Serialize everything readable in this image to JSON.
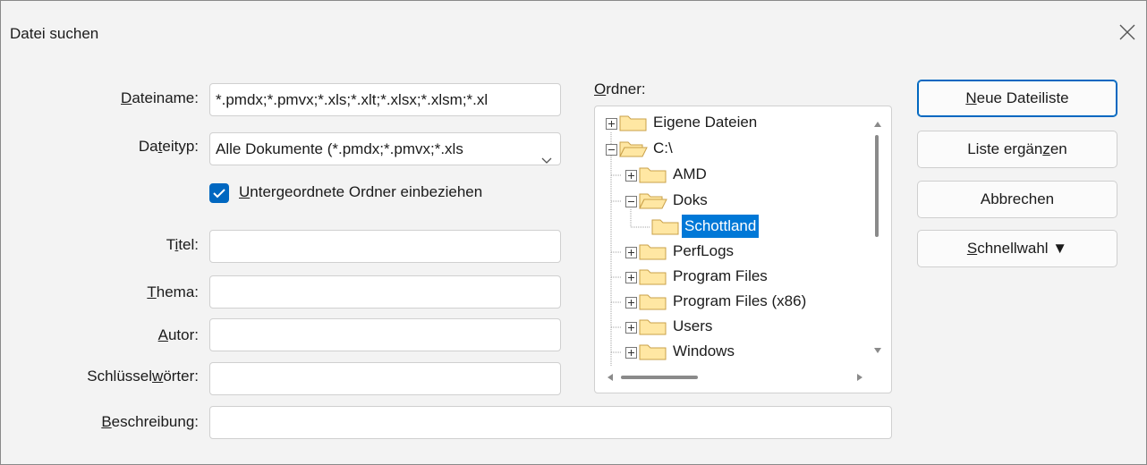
{
  "window": {
    "title": "Datei suchen"
  },
  "form": {
    "filename_label": "Dateiname:",
    "filename_value": "*.pmdx;*.pmvx;*.xls;*.xlt;*.xlsx;*.xlsm;*.xl",
    "filetype_label": "Dateityp:",
    "filetype_value": "Alle Dokumente (*.pmdx;*.pmvx;*.xls",
    "subfolders_label": "Untergeordnete Ordner einbeziehen",
    "subfolders_checked": true,
    "title_label": "Titel:",
    "title_value": "",
    "subject_label": "Thema:",
    "subject_value": "",
    "author_label": "Autor:",
    "author_value": "",
    "keywords_label": "Schlüsselwörter:",
    "keywords_value": "",
    "description_label": "Beschreibung:",
    "description_value": ""
  },
  "folders": {
    "label": "Ordner:",
    "items": [
      {
        "label": "Eigene Dateien",
        "expander": "plus"
      },
      {
        "label": "C:\\",
        "expander": "minus"
      },
      {
        "label": "AMD",
        "expander": "plus"
      },
      {
        "label": "Doks",
        "expander": "minus"
      },
      {
        "label": "Schottland",
        "expander": "none",
        "selected": true
      },
      {
        "label": "PerfLogs",
        "expander": "plus"
      },
      {
        "label": "Program Files",
        "expander": "plus"
      },
      {
        "label": "Program Files (x86)",
        "expander": "plus"
      },
      {
        "label": "Users",
        "expander": "plus"
      },
      {
        "label": "Windows",
        "expander": "plus"
      }
    ]
  },
  "buttons": {
    "new_list": "Neue Dateiliste",
    "add_to_list": "Liste ergänzen",
    "cancel": "Abbrechen",
    "quick_select": "Schnellwahl ▼"
  },
  "colors": {
    "accent": "#0067c0",
    "selection": "#0078d7",
    "folder_fill": "#ffe7a3",
    "folder_stroke": "#c9a04a"
  }
}
